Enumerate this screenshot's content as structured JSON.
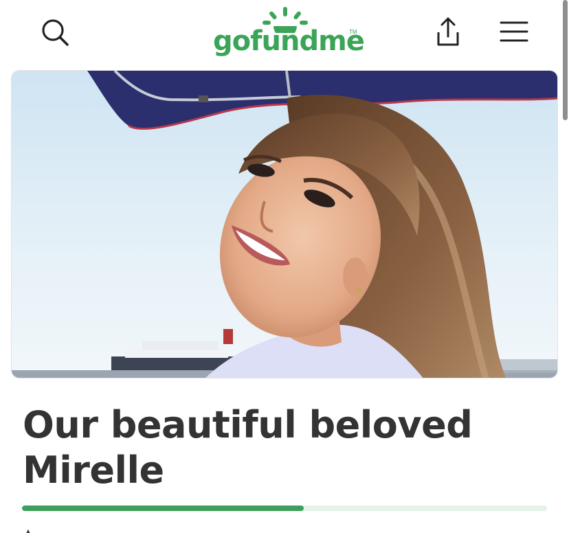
{
  "header": {
    "logo_text": "gofundme",
    "logo_tm": "TM",
    "brand_color": "#3aa457",
    "search_icon": "search-icon",
    "share_icon": "share-icon",
    "menu_icon": "hamburger-menu-icon"
  },
  "campaign": {
    "title": "Our beautiful beloved Mirelle",
    "progress_fraction": 0.537,
    "progress_color": "#3e9f5c",
    "progress_track_color": "#e4f3e9"
  }
}
